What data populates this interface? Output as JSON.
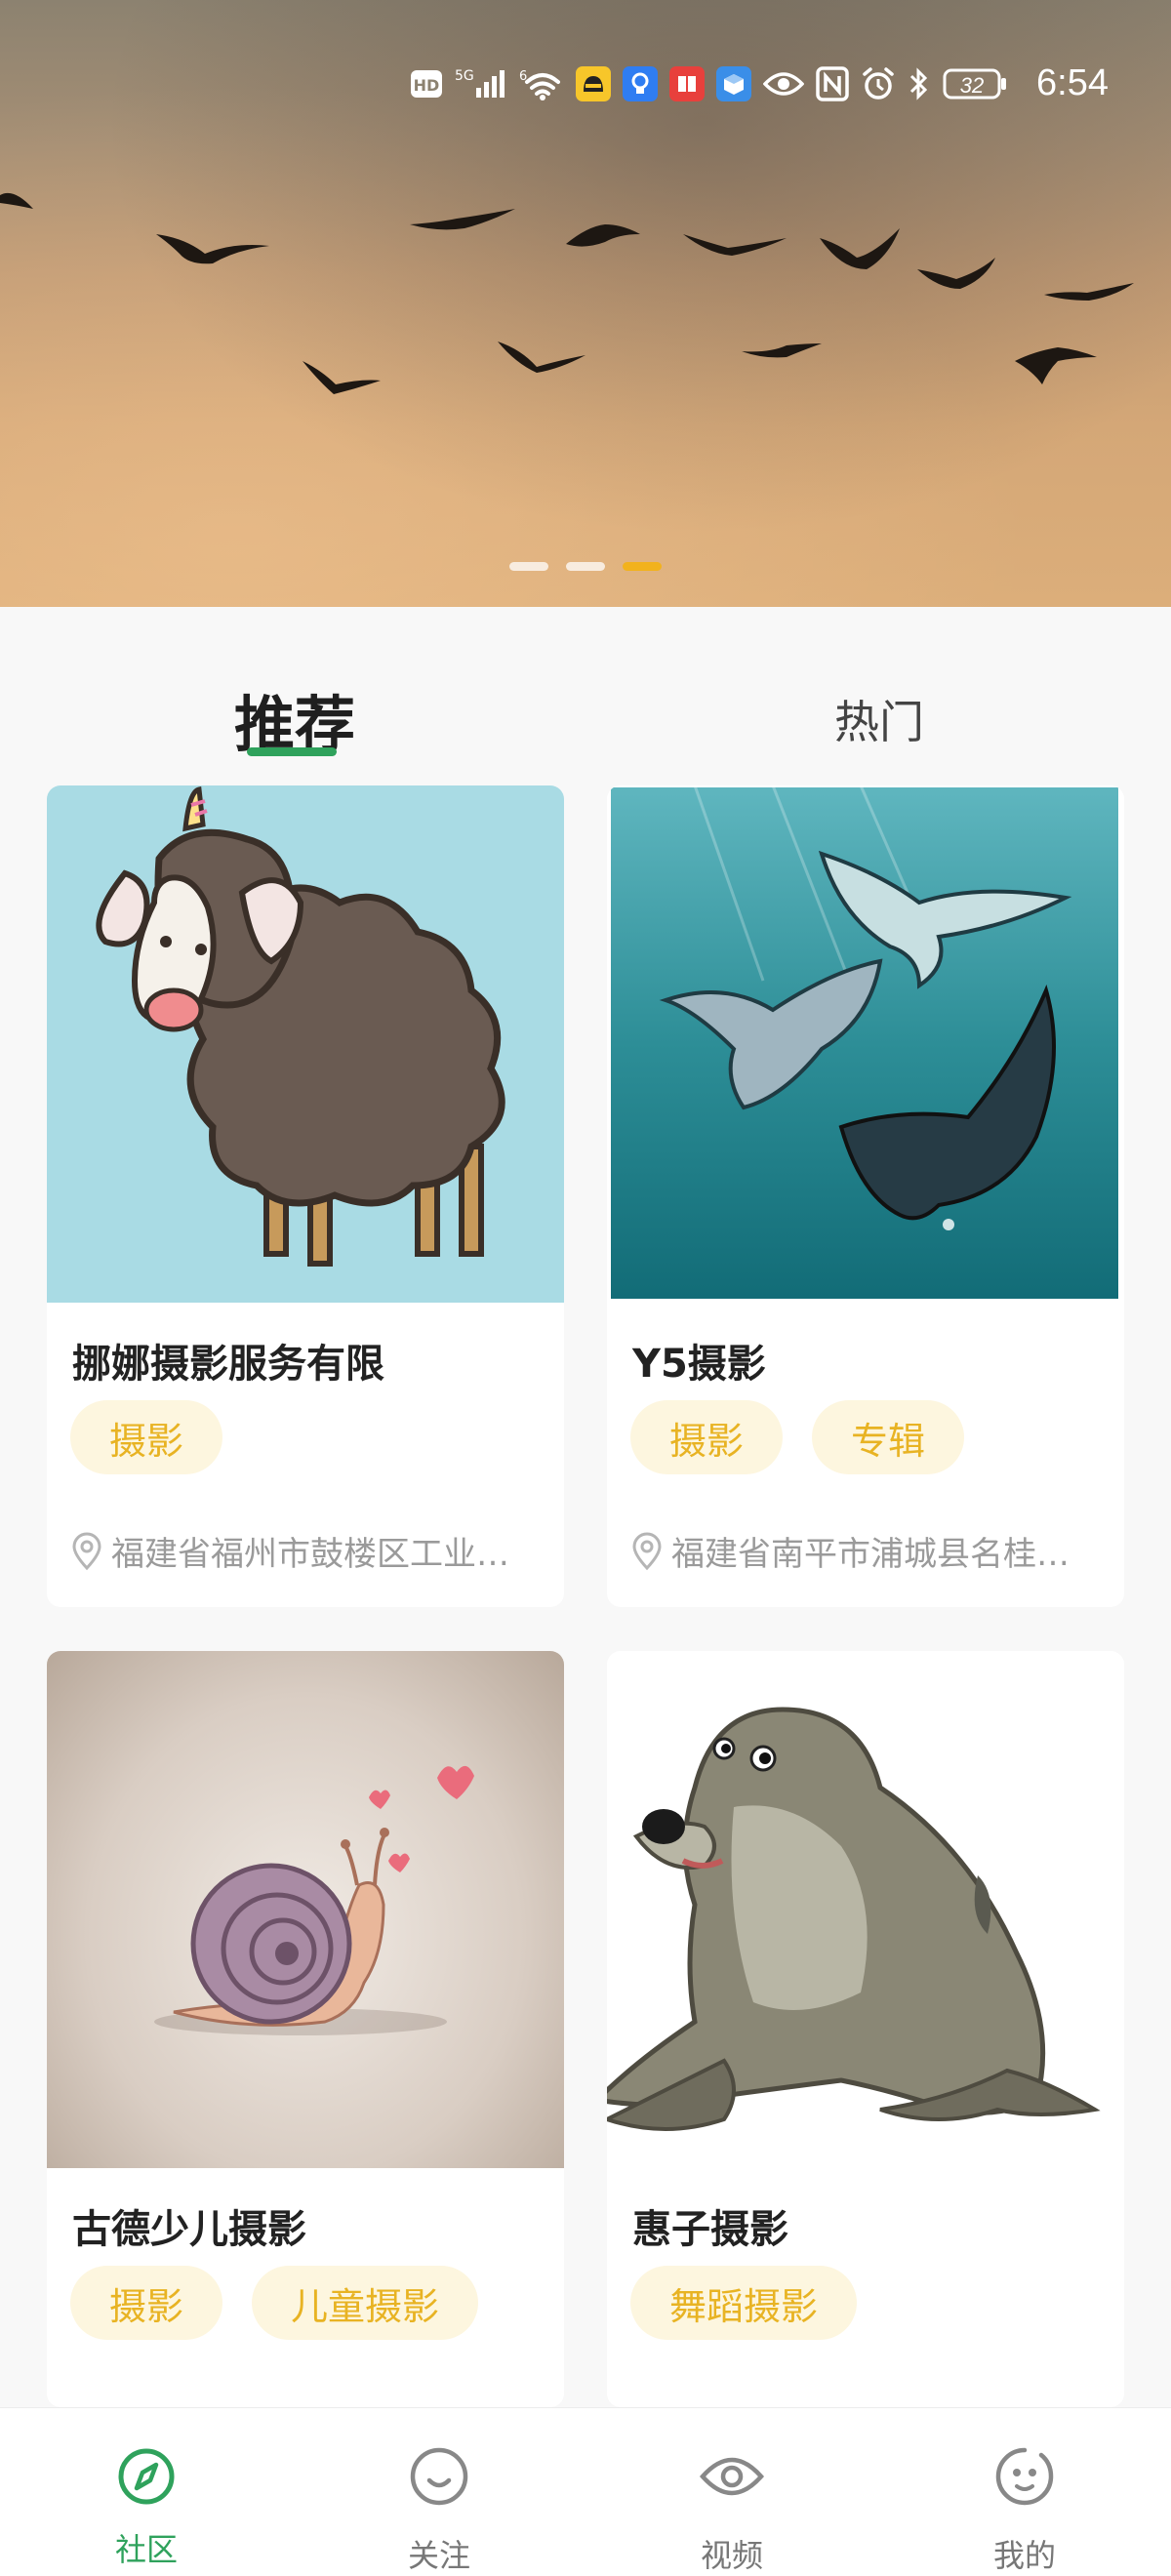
{
  "status_bar": {
    "time": "6:54",
    "battery": "32",
    "network_label": "HD",
    "signal_label": "5G"
  },
  "banner": {
    "slides_count": 3,
    "active_slide": 3
  },
  "tabs": [
    {
      "label": "推荐",
      "active": true
    },
    {
      "label": "热门",
      "active": false
    }
  ],
  "cards": [
    {
      "title": "挪娜摄影服务有限",
      "tags": [
        "摄影"
      ],
      "location": "福建省福州市鼓楼区工业…",
      "image": "sheep-illustration"
    },
    {
      "title": "Y5摄影",
      "tags": [
        "摄影",
        "专辑"
      ],
      "location": "福建省南平市浦城县名桂…",
      "image": "manta-ray-illustration"
    },
    {
      "title": "古德少儿摄影",
      "tags": [
        "摄影",
        "儿童摄影"
      ],
      "location": "",
      "image": "snail-illustration"
    },
    {
      "title": "惠子摄影",
      "tags": [
        "舞蹈摄影"
      ],
      "location": "",
      "image": "seal-illustration"
    }
  ],
  "bottom_nav": [
    {
      "label": "社区",
      "icon": "compass-icon",
      "active": true
    },
    {
      "label": "关注",
      "icon": "smile-icon",
      "active": false
    },
    {
      "label": "视频",
      "icon": "eye-icon",
      "active": false
    },
    {
      "label": "我的",
      "icon": "face-icon",
      "active": false
    }
  ],
  "colors": {
    "accent_green": "#2fa25c",
    "tag_text": "#e8b323",
    "tag_bg": "#fdf6df",
    "dot_active": "#f2b21c"
  }
}
